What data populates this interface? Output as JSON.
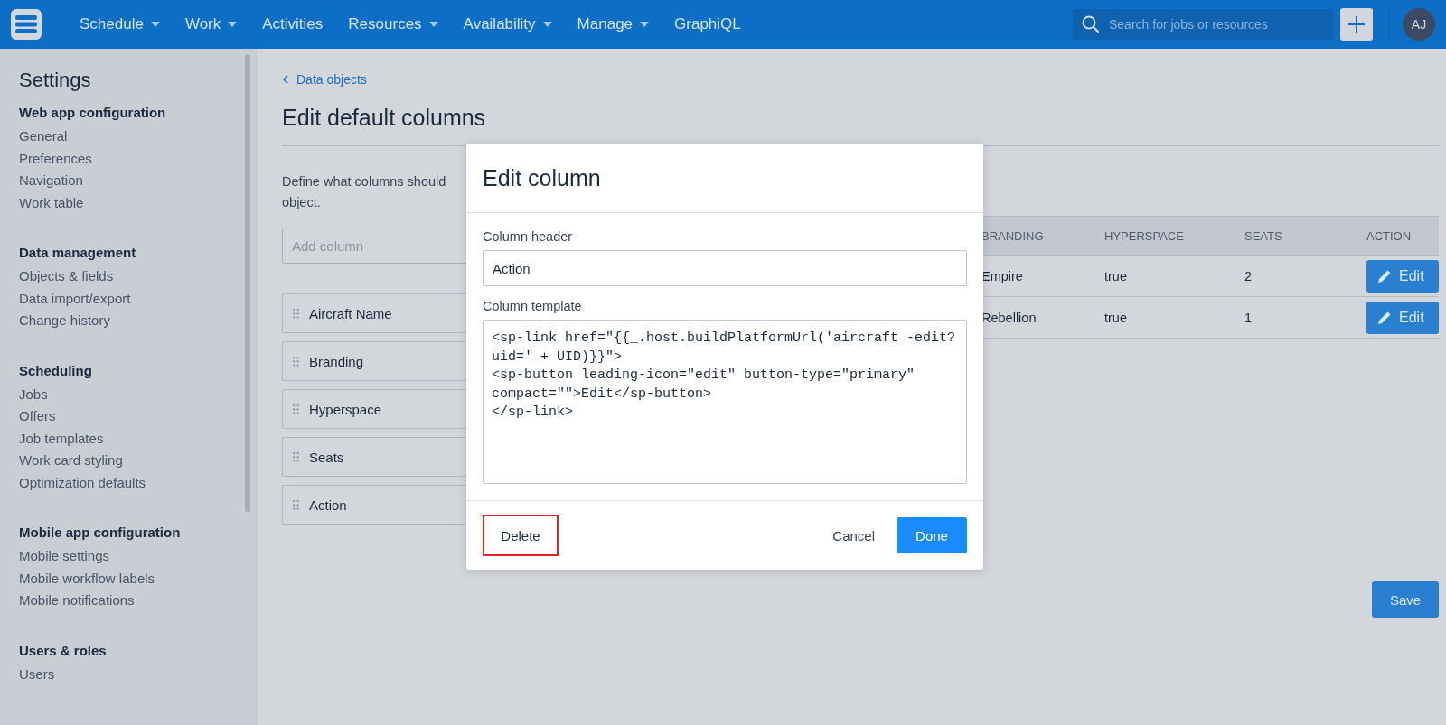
{
  "topbar": {
    "nav": [
      {
        "label": "Schedule",
        "dropdown": true
      },
      {
        "label": "Work",
        "dropdown": true
      },
      {
        "label": "Activities",
        "dropdown": false
      },
      {
        "label": "Resources",
        "dropdown": true
      },
      {
        "label": "Availability",
        "dropdown": true
      },
      {
        "label": "Manage",
        "dropdown": true
      },
      {
        "label": "GraphiQL",
        "dropdown": false
      }
    ],
    "search": {
      "placeholder": "Search for jobs or resources"
    },
    "avatar": "AJ"
  },
  "sidebar": {
    "title": "Settings",
    "sections": [
      {
        "heading": "Web app configuration",
        "items": [
          "General",
          "Preferences",
          "Navigation",
          "Work table"
        ]
      },
      {
        "heading": "Data management",
        "items": [
          "Objects & fields",
          "Data import/export",
          "Change history"
        ]
      },
      {
        "heading": "Scheduling",
        "items": [
          "Jobs",
          "Offers",
          "Job templates",
          "Work card styling",
          "Optimization defaults"
        ]
      },
      {
        "heading": "Mobile app configuration",
        "items": [
          "Mobile settings",
          "Mobile workflow labels",
          "Mobile notifications"
        ]
      },
      {
        "heading": "Users & roles",
        "items": [
          "Users"
        ]
      }
    ]
  },
  "page": {
    "breadcrumb": "Data objects",
    "title": "Edit default columns",
    "description_lines": [
      "Define what columns should",
      "object."
    ],
    "add_column": {
      "placeholder": "Add column"
    },
    "columns": [
      "Aircraft Name",
      "Branding",
      "Hyperspace",
      "Seats",
      "Action"
    ],
    "table": {
      "columns": [
        "BRANDING",
        "HYPERSPACE",
        "SEATS",
        "ACTION"
      ],
      "rows": [
        {
          "cells": [
            "Empire",
            "true",
            "2"
          ],
          "action": "Edit"
        },
        {
          "cells": [
            "Rebellion",
            "true",
            "1"
          ],
          "action": "Edit"
        }
      ]
    },
    "save": "Save"
  },
  "modal": {
    "title": "Edit column",
    "header_label": "Column header",
    "header_value": "Action",
    "template_label": "Column template",
    "template_value": "<sp-link href=\"{{_.host.buildPlatformUrl('aircraft -edit?uid=' + UID)}}\">\n<sp-button leading-icon=\"edit\" button-type=\"primary\" compact=\"\">Edit</sp-button>\n</sp-link>",
    "delete": "Delete",
    "delete_highlighted": true,
    "cancel": "Cancel",
    "done": "Done"
  }
}
